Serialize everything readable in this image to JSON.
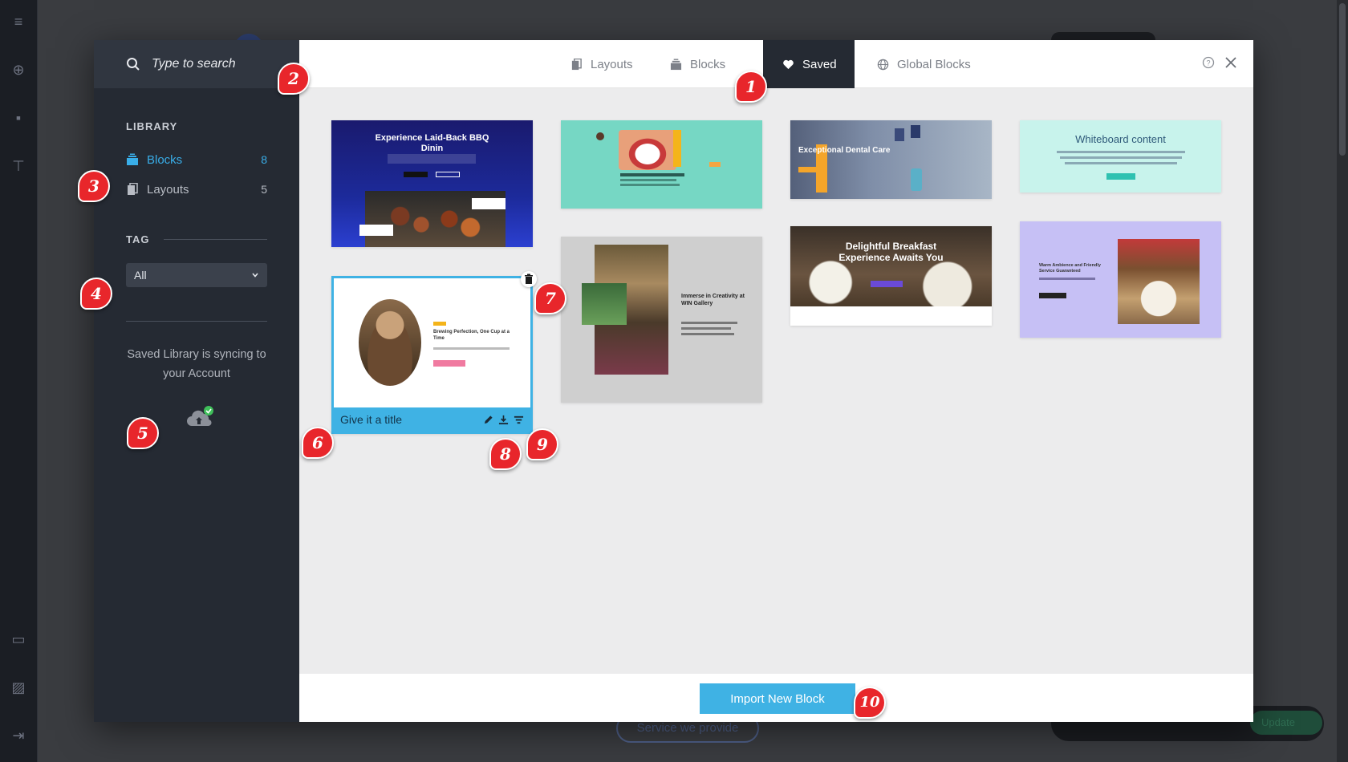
{
  "sidebar": {
    "search_placeholder": "Type to search",
    "library_title": "LIBRARY",
    "library_items": [
      {
        "label": "Blocks",
        "count": "8",
        "icon": "blocks-icon",
        "active": true
      },
      {
        "label": "Layouts",
        "count": "5",
        "icon": "layouts-icon",
        "active": false
      }
    ],
    "tag_title": "TAG",
    "tag_value": "All",
    "sync_text": "Saved Library is syncing to your Account"
  },
  "tabs": [
    {
      "label": "Layouts",
      "icon": "layouts-icon"
    },
    {
      "label": "Blocks",
      "icon": "blocks-icon"
    },
    {
      "label": "Saved",
      "icon": "heart-icon",
      "active": true
    },
    {
      "label": "Global Blocks",
      "icon": "globe-icon"
    }
  ],
  "cards": {
    "bbq_title": "Experience Laid-Back BBQ Dinin",
    "coffee_heading": "Brewing Perfection, One Cup at a Time",
    "coffee_footer": "Give it a title",
    "gallery_heading": "Immerse in Creativity at WIN Gallery",
    "dental_heading": "Exceptional Dental Care",
    "breakfast_heading": "Delightful Breakfast Experience Awaits You",
    "whiteboard_heading": "Whiteboard content",
    "ambience_heading": "Warm Ambience and Friendly Service Guaranteed"
  },
  "import_button": "Import New Block",
  "background": {
    "ghost_pill": "Service we provide",
    "ghost_update": "Update"
  },
  "callouts": [
    "1",
    "2",
    "3",
    "4",
    "5",
    "6",
    "7",
    "8",
    "9",
    "10"
  ],
  "colors": {
    "accent": "#39aee9",
    "sidebar_bg": "#252a33",
    "callout_red": "#e8262b",
    "import_button": "#3fb2e4"
  }
}
